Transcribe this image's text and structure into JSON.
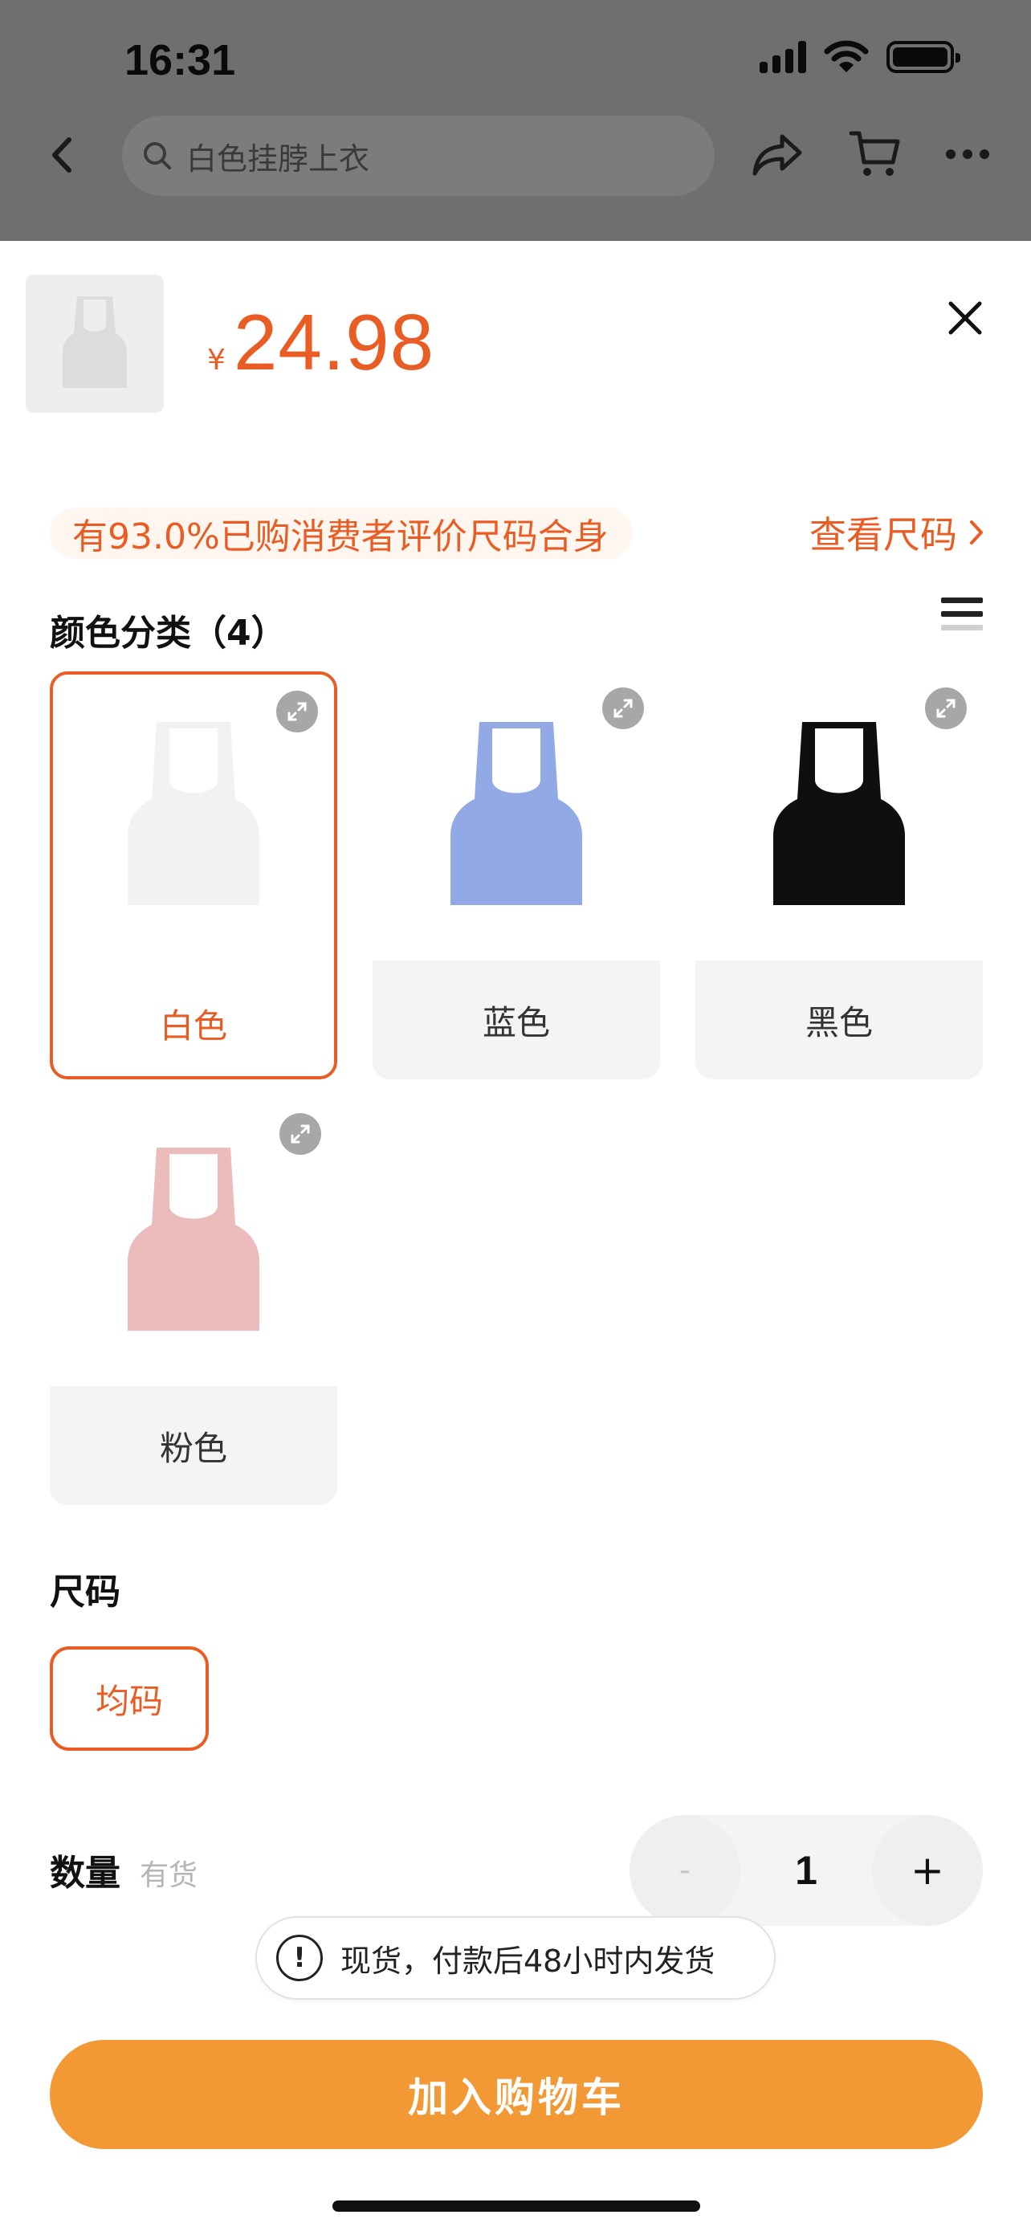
{
  "status_bar": {
    "time": "16:31"
  },
  "nav": {
    "search_text": "白色挂脖上衣"
  },
  "product": {
    "currency": "¥",
    "price": "24.98"
  },
  "fit_notice": "有93.0%已购消费者评价尺码合身",
  "size_chart_link": "查看尺码",
  "color_section": {
    "title": "颜色分类（4）",
    "options": [
      {
        "label": "白色",
        "color": "#f2f2f2",
        "selected": true
      },
      {
        "label": "蓝色",
        "color": "#93a9e6",
        "selected": false
      },
      {
        "label": "黑色",
        "color": "#0f0f0f",
        "selected": false
      },
      {
        "label": "粉色",
        "color": "#ecbcbd",
        "selected": false
      }
    ]
  },
  "size_section": {
    "title": "尺码",
    "options": [
      {
        "label": "均码",
        "selected": true
      }
    ]
  },
  "quantity": {
    "title": "数量",
    "stock": "有货",
    "minus": "-",
    "value": "1",
    "plus": "+"
  },
  "shipping_notice": "现货，付款后48小时内发货",
  "add_to_cart": "加入购物车",
  "colors": {
    "accent": "#e95d25",
    "button": "#f29935"
  }
}
